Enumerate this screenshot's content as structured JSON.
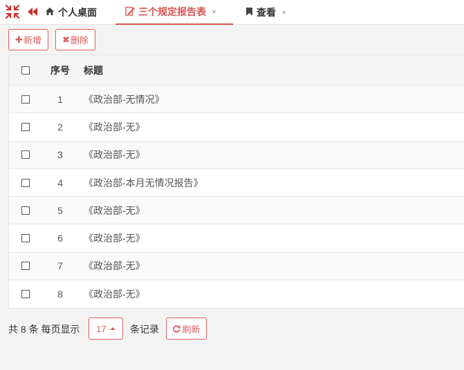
{
  "tabs": [
    {
      "label": "个人桌面",
      "icon": "home-icon",
      "active": false,
      "closable": false
    },
    {
      "label": "三个规定报告表",
      "icon": "edit-icon",
      "active": true,
      "closable": true
    },
    {
      "label": "查看",
      "icon": "bookmark-icon",
      "active": false,
      "closable": true
    }
  ],
  "tab_close_glyph": "×",
  "toolbar": {
    "add_label": "新增",
    "add_glyph": "✚",
    "delete_label": "删除",
    "delete_glyph": "✖"
  },
  "table": {
    "columns": [
      "序号",
      "标题"
    ],
    "rows": [
      {
        "no": "1",
        "title": "《政治部-无情况》"
      },
      {
        "no": "2",
        "title": "《政治部-无》"
      },
      {
        "no": "3",
        "title": "《政治部-无》"
      },
      {
        "no": "4",
        "title": "《政治部-本月无情况报告》"
      },
      {
        "no": "5",
        "title": "《政治部-无》"
      },
      {
        "no": "6",
        "title": "《政治部-无》"
      },
      {
        "no": "7",
        "title": "《政治部-无》"
      },
      {
        "no": "8",
        "title": "《政治部-无》"
      }
    ]
  },
  "pagination": {
    "summary": "共 8 条 每页显示",
    "page_size": "17",
    "suffix": "条记录",
    "refresh_label": "刷新"
  },
  "colors": {
    "accent": "#e25a5a",
    "active_tab": "#d9534f",
    "tab_icon": "#c9302c"
  }
}
